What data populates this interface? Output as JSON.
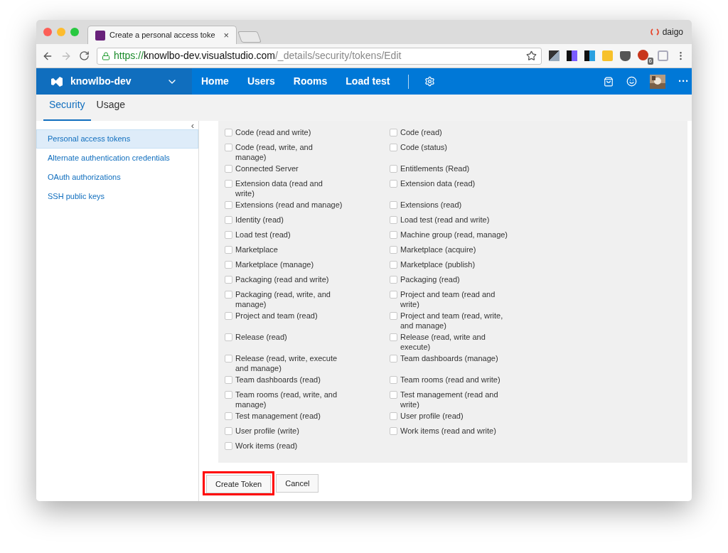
{
  "browser": {
    "tab": {
      "title": "Create a personal access toke",
      "close": "×"
    },
    "profile": "daigo",
    "address": {
      "scheme": "https://",
      "host": "knowlbo-dev.visualstudio.com",
      "path": "/_details/security/tokens/Edit"
    },
    "extension_badge": "6"
  },
  "app_bar": {
    "account": "knowlbo-dev",
    "nav": [
      {
        "label": "Home"
      },
      {
        "label": "Users"
      },
      {
        "label": "Rooms"
      },
      {
        "label": "Load test"
      }
    ],
    "more": "···"
  },
  "tabs": [
    {
      "label": "Security",
      "selected": true
    },
    {
      "label": "Usage",
      "selected": false
    }
  ],
  "sidebar": {
    "collapse": "‹",
    "items": [
      {
        "label": "Personal access tokens",
        "selected": true
      },
      {
        "label": "Alternate authentication credentials",
        "selected": false
      },
      {
        "label": "OAuth authorizations",
        "selected": false
      },
      {
        "label": "SSH public keys",
        "selected": false
      }
    ]
  },
  "scopes": [
    [
      {
        "label": "Code (read and write)",
        "checked": false
      },
      {
        "label": "Code (read)",
        "checked": false
      }
    ],
    [
      {
        "label": "Code (read, write, and manage)",
        "checked": false
      },
      {
        "label": "Code (status)",
        "checked": false
      }
    ],
    [
      {
        "label": "Connected Server",
        "checked": false
      },
      {
        "label": "Entitlements (Read)",
        "checked": false
      }
    ],
    [
      {
        "label": "Extension data (read and write)",
        "checked": false
      },
      {
        "label": "Extension data (read)",
        "checked": false
      }
    ],
    [
      {
        "label": "Extensions (read and manage)",
        "checked": false
      },
      {
        "label": "Extensions (read)",
        "checked": false
      }
    ],
    [
      {
        "label": "Identity (read)",
        "checked": false
      },
      {
        "label": "Load test (read and write)",
        "checked": false
      }
    ],
    [
      {
        "label": "Load test (read)",
        "checked": false
      },
      {
        "label": "Machine group (read, manage)",
        "checked": false
      }
    ],
    [
      {
        "label": "Marketplace",
        "checked": false
      },
      {
        "label": "Marketplace (acquire)",
        "checked": false
      }
    ],
    [
      {
        "label": "Marketplace (manage)",
        "checked": false
      },
      {
        "label": "Marketplace (publish)",
        "checked": false
      }
    ],
    [
      {
        "label": "Packaging (read and write)",
        "checked": false
      },
      {
        "label": "Packaging (read)",
        "checked": false
      }
    ],
    [
      {
        "label": "Packaging (read, write, and manage)",
        "checked": false
      },
      {
        "label": "Project and team (read and write)",
        "checked": false
      }
    ],
    [
      {
        "label": "Project and team (read)",
        "checked": false
      },
      {
        "label": "Project and team (read, write, and manage)",
        "checked": false
      }
    ],
    [
      {
        "label": "Release (read)",
        "checked": false
      },
      {
        "label": "Release (read, write and execute)",
        "checked": false
      }
    ],
    [
      {
        "label": "Release (read, write, execute and manage)",
        "checked": false
      },
      {
        "label": "Team dashboards (manage)",
        "checked": false
      }
    ],
    [
      {
        "label": "Team dashboards (read)",
        "checked": false
      },
      {
        "label": "Team rooms (read and write)",
        "checked": false
      }
    ],
    [
      {
        "label": "Team rooms (read, write, and manage)",
        "checked": false
      },
      {
        "label": "Test management (read and write)",
        "checked": false
      }
    ],
    [
      {
        "label": "Test management (read)",
        "checked": false
      },
      {
        "label": "User profile (read)",
        "checked": false
      }
    ],
    [
      {
        "label": "User profile (write)",
        "checked": false
      },
      {
        "label": "Work items (read and write)",
        "checked": false
      }
    ],
    [
      {
        "label": "Work items (read)",
        "checked": false
      }
    ]
  ],
  "buttons": [
    {
      "label": "Create Token",
      "highlighted": true
    },
    {
      "label": "Cancel",
      "highlighted": false
    }
  ]
}
